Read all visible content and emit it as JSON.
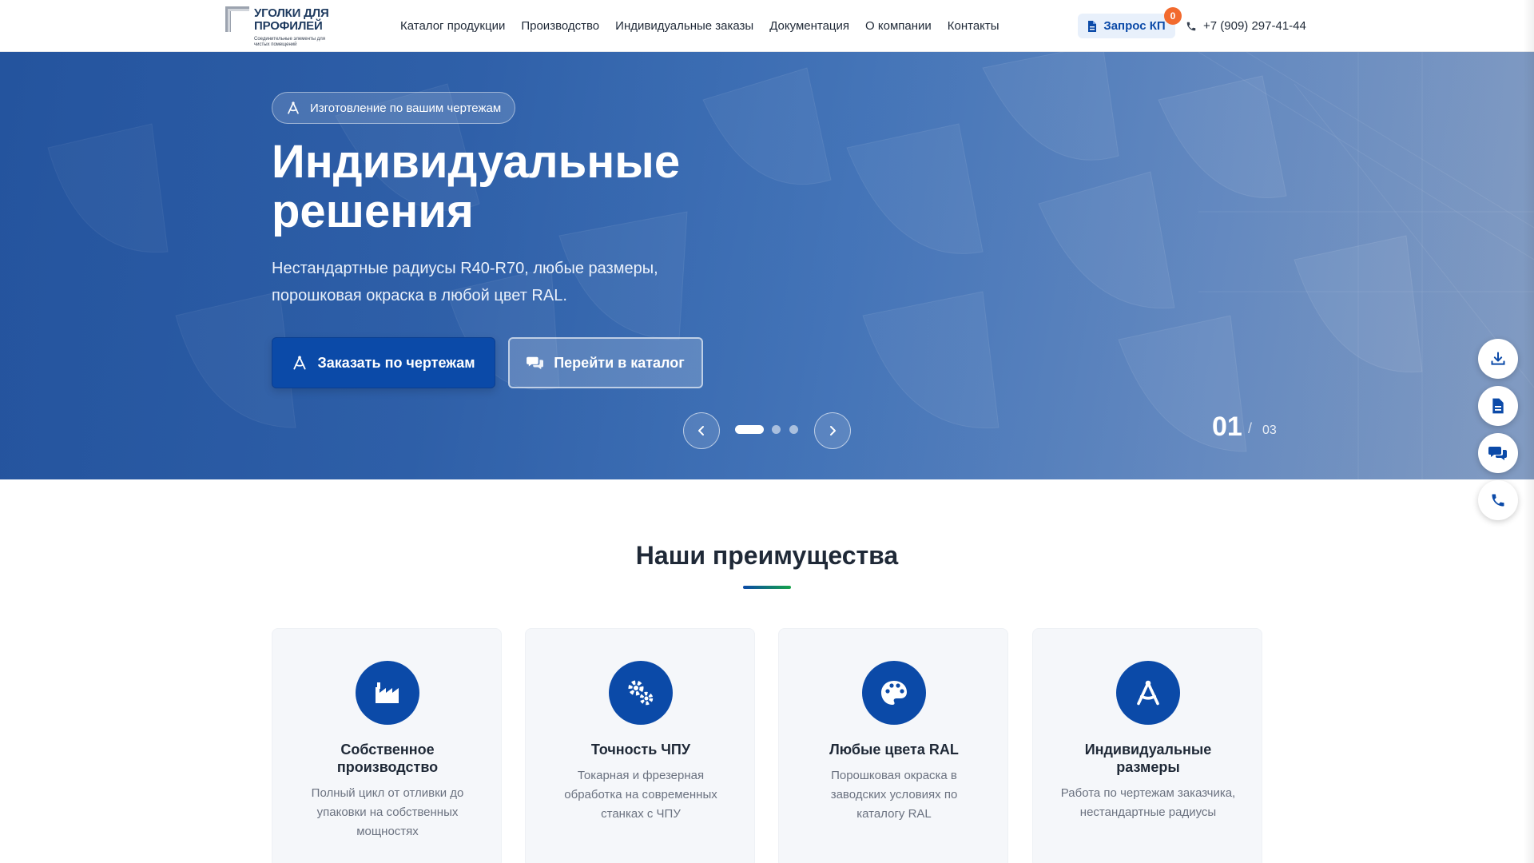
{
  "header": {
    "logo": {
      "title_line1": "УГОЛКИ ДЛЯ",
      "title_line2": "ПРОФИЛЕЙ",
      "subtitle": "Соединительные элементы для чистых помещений"
    },
    "nav": [
      {
        "label": "Каталог продукции"
      },
      {
        "label": "Производство"
      },
      {
        "label": "Индивидуальные заказы"
      },
      {
        "label": "Документация"
      },
      {
        "label": "О компании"
      },
      {
        "label": "Контакты"
      }
    ],
    "kp_button": {
      "label": "Запрос КП",
      "icon": "document-icon",
      "badge": "0"
    },
    "phone": {
      "label": "+7 (909) 297-41-44",
      "icon": "phone-icon"
    }
  },
  "hero": {
    "badge": {
      "label": "Изготовление по вашим чертежам",
      "icon": "compass-icon"
    },
    "title_line1": "Индивидуальные",
    "title_line2": "решения",
    "description_line1": "Нестандартные радиусы R40-R70, любые размеры,",
    "description_line2": "порошковая окраска в любой цвет RAL.",
    "primary_button": {
      "label": "Заказать по чертежам",
      "icon": "compass-icon"
    },
    "secondary_button": {
      "label": "Перейти в каталог",
      "icon": "chat-icon"
    },
    "slider": {
      "current": "01",
      "separator": "/",
      "total": "03",
      "active_index": 1,
      "count": 3
    }
  },
  "floating_actions": [
    {
      "name": "download-icon"
    },
    {
      "name": "document-icon"
    },
    {
      "name": "chat-icon"
    },
    {
      "name": "phone-icon"
    }
  ],
  "advantages": {
    "title": "Наши преимущества",
    "cards": [
      {
        "icon": "factory-icon",
        "title_line1": "Собственное",
        "title_line2": "производство",
        "desc_lines": [
          "Полный цикл от отливки до",
          "упаковки на собственных",
          "мощностях"
        ]
      },
      {
        "icon": "gears-icon",
        "title_line1": "Точность ЧПУ",
        "title_line2": "",
        "desc_lines": [
          "Токарная и фрезерная",
          "обработка на современных",
          "станках с ЧПУ"
        ]
      },
      {
        "icon": "palette-icon",
        "title_line1": "Любые цвета RAL",
        "title_line2": "",
        "desc_lines": [
          "Порошковая окраска в",
          "заводских условиях по",
          "каталогу RAL"
        ]
      },
      {
        "icon": "compass-icon",
        "title_line1": "Индивидуальные",
        "title_line2": "размеры",
        "desc_lines": [
          "Работа по чертежам заказчика,",
          "нестандартные радиусы"
        ]
      }
    ]
  },
  "colors": {
    "brand_blue": "#0b4aa8",
    "badge_orange": "#f26a2e",
    "accent_green": "#16a34a",
    "card_bg": "#f5f7fa"
  }
}
